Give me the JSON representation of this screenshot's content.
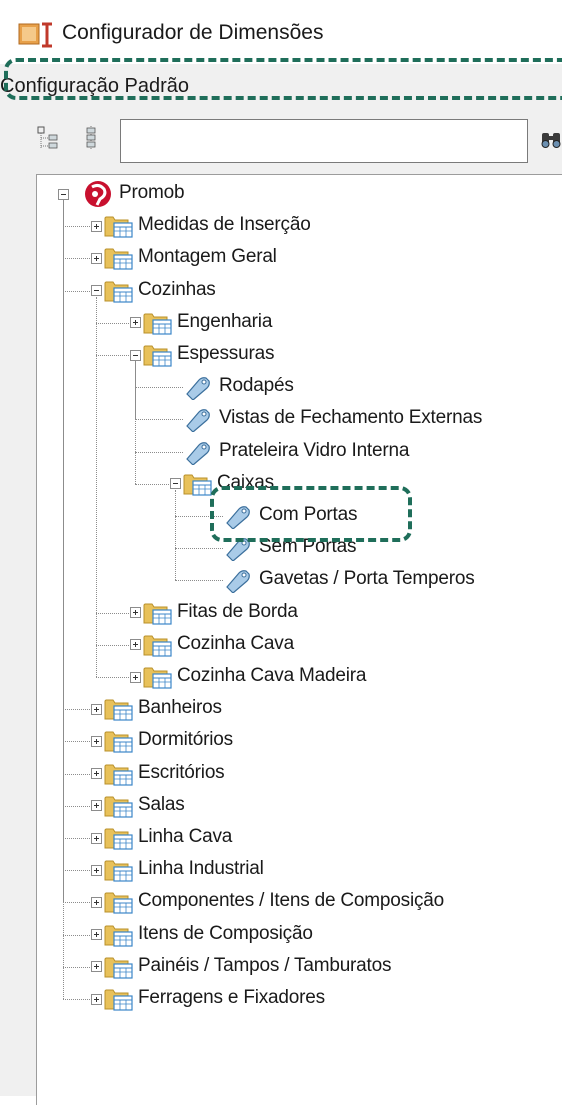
{
  "window": {
    "title": "Configurador de Dimensões",
    "app_icon": "dimension-configurator-icon"
  },
  "config_bar": {
    "label": "Configuração Padrão"
  },
  "toolbar": {
    "icons": [
      "tree-expand-icon",
      "tree-collapse-icon",
      "binoculars-search-icon"
    ],
    "search_value": ""
  },
  "tree": {
    "root": "Promob",
    "nodes": [
      {
        "label": "Medidas de Inserção",
        "type": "folder",
        "depth": 1,
        "expanded": false
      },
      {
        "label": "Montagem Geral",
        "type": "folder",
        "depth": 1,
        "expanded": false
      },
      {
        "label": "Cozinhas",
        "type": "folder",
        "depth": 1,
        "expanded": true
      },
      {
        "label": "Engenharia",
        "type": "folder",
        "depth": 2,
        "expanded": false
      },
      {
        "label": "Espessuras",
        "type": "folder",
        "depth": 2,
        "expanded": true
      },
      {
        "label": "Rodapés",
        "type": "item",
        "depth": 3
      },
      {
        "label": "Vistas de Fechamento Externas",
        "type": "item",
        "depth": 3
      },
      {
        "label": "Prateleira Vidro Interna",
        "type": "item",
        "depth": 3
      },
      {
        "label": "Caixas",
        "type": "folder",
        "depth": 3,
        "expanded": true
      },
      {
        "label": "Com Portas",
        "type": "item",
        "depth": 4,
        "highlighted": true
      },
      {
        "label": "Sem Portas",
        "type": "item",
        "depth": 4
      },
      {
        "label": "Gavetas / Porta Temperos",
        "type": "item",
        "depth": 4
      },
      {
        "label": "Fitas de Borda",
        "type": "folder",
        "depth": 2,
        "expanded": false
      },
      {
        "label": "Cozinha Cava",
        "type": "folder",
        "depth": 2,
        "expanded": false
      },
      {
        "label": "Cozinha Cava Madeira",
        "type": "folder",
        "depth": 2,
        "expanded": false
      },
      {
        "label": "Banheiros",
        "type": "folder",
        "depth": 1,
        "expanded": false
      },
      {
        "label": "Dormitórios",
        "type": "folder",
        "depth": 1,
        "expanded": false
      },
      {
        "label": "Escritórios",
        "type": "folder",
        "depth": 1,
        "expanded": false
      },
      {
        "label": "Salas",
        "type": "folder",
        "depth": 1,
        "expanded": false
      },
      {
        "label": "Linha Cava",
        "type": "folder",
        "depth": 1,
        "expanded": false
      },
      {
        "label": "Linha Industrial",
        "type": "folder",
        "depth": 1,
        "expanded": false
      },
      {
        "label": "Componentes / Itens de Composição",
        "type": "folder",
        "depth": 1,
        "expanded": false
      },
      {
        "label": "Itens de Composição",
        "type": "folder",
        "depth": 1,
        "expanded": false
      },
      {
        "label": "Painéis / Tampos / Tamburatos",
        "type": "folder",
        "depth": 1,
        "expanded": false
      },
      {
        "label": "Ferragens e Fixadores",
        "type": "folder",
        "depth": 1,
        "expanded": false
      }
    ]
  },
  "colors": {
    "highlight": "#1f6e5a",
    "folder": "#e8c15a",
    "item_tag": "#3b86c8"
  }
}
